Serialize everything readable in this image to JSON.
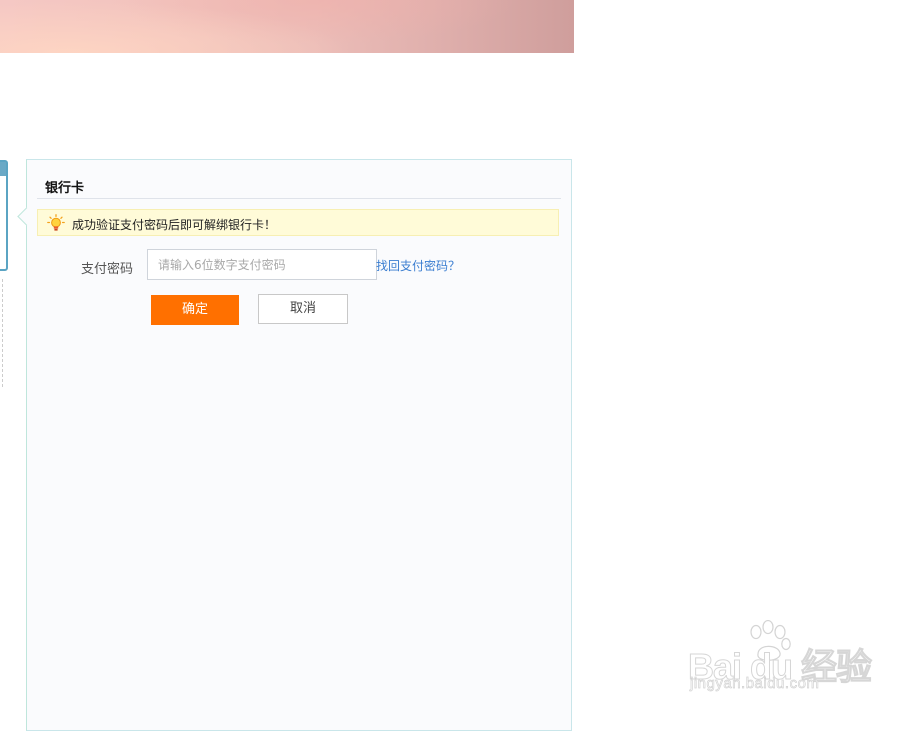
{
  "banner": {},
  "panel": {
    "title": "银行卡",
    "notice": "成功验证支付密码后即可解绑银行卡！",
    "password_label": "支付密码",
    "password_value": "",
    "password_placeholder": "请输入6位数字支付密码",
    "forgot_link": "找回支付密码？",
    "confirm_label": "确定",
    "cancel_label": "取消"
  },
  "watermark": {
    "logo_text": "Bai du 经验",
    "url": "jingyan.baidu.com"
  },
  "icons": {
    "notice_icon": "lightbulb-icon",
    "watermark_icon": "paw-icon"
  },
  "colors": {
    "accent": "#ff7000",
    "link": "#3a7dd0",
    "notice_bg": "#fffbd8",
    "panel_border": "#c9e6ea"
  }
}
